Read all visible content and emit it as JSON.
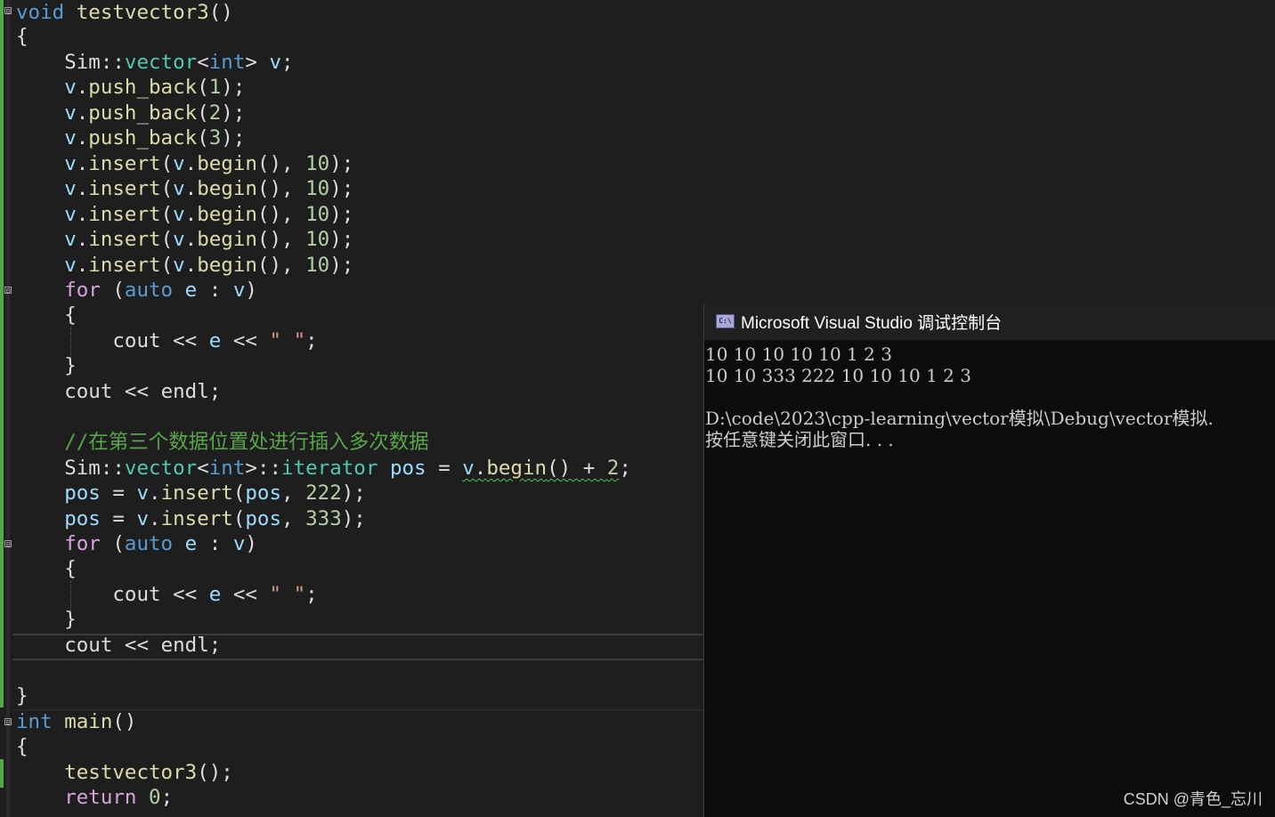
{
  "editor": {
    "code": {
      "l1": {
        "kw": "void",
        "fn": "testvector3",
        "p": "()"
      },
      "l2": {
        "p": "{"
      },
      "l3": {
        "ns": "Sim",
        "sep": "::",
        "typ": "vector",
        "lt": "<",
        "kw": "int",
        "gt": ">",
        "var": "v",
        "end": ";"
      },
      "l4": {
        "var": "v",
        "dot": ".",
        "fn": "push_back",
        "po": "(",
        "num": "1",
        "pc": ");"
      },
      "l5": {
        "var": "v",
        "dot": ".",
        "fn": "push_back",
        "po": "(",
        "num": "2",
        "pc": ");"
      },
      "l6": {
        "var": "v",
        "dot": ".",
        "fn": "push_back",
        "po": "(",
        "num": "3",
        "pc": ");"
      },
      "l7": {
        "var": "v",
        "dot": ".",
        "fn": "insert",
        "po": "(",
        "var2": "v",
        "dot2": ".",
        "fn2": "begin",
        "pp": "(), ",
        "num": "10",
        "pc": ");"
      },
      "l8": {
        "var": "v",
        "dot": ".",
        "fn": "insert",
        "po": "(",
        "var2": "v",
        "dot2": ".",
        "fn2": "begin",
        "pp": "(), ",
        "num": "10",
        "pc": ");"
      },
      "l9": {
        "var": "v",
        "dot": ".",
        "fn": "insert",
        "po": "(",
        "var2": "v",
        "dot2": ".",
        "fn2": "begin",
        "pp": "(), ",
        "num": "10",
        "pc": ");"
      },
      "l10": {
        "var": "v",
        "dot": ".",
        "fn": "insert",
        "po": "(",
        "var2": "v",
        "dot2": ".",
        "fn2": "begin",
        "pp": "(), ",
        "num": "10",
        "pc": ");"
      },
      "l11": {
        "var": "v",
        "dot": ".",
        "fn": "insert",
        "po": "(",
        "var2": "v",
        "dot2": ".",
        "fn2": "begin",
        "pp": "(), ",
        "num": "10",
        "pc": ");"
      },
      "l12": {
        "ctl": "for",
        "po": " (",
        "kw": "auto",
        "sp1": " ",
        "var": "e",
        "colon": " : ",
        "var2": "v",
        "pc": ")"
      },
      "l13": {
        "p": "{"
      },
      "l14": {
        "ident": "cout",
        "op1": " << ",
        "var": "e",
        "op2": " << ",
        "str": "\" \"",
        "end": ";"
      },
      "l15": {
        "p": "}"
      },
      "l16": {
        "ident": "cout",
        "op1": " << ",
        "ident2": "endl",
        "end": ";"
      },
      "l18": {
        "cmt": "//在第三个数据位置处进行插入多次数据"
      },
      "l19": {
        "ns": "Sim",
        "sep": "::",
        "typ": "vector",
        "lt": "<",
        "kw": "int",
        "gt": ">",
        "sep2": "::",
        "typ2": "iterator",
        "sp": " ",
        "var": "pos",
        "eq": " = ",
        "var2": "v",
        "dot": ".",
        "fn": "begin",
        "pp": "() + ",
        "num": "2",
        "end": ";"
      },
      "l20": {
        "var": "pos",
        "eq": " = ",
        "var2": "v",
        "dot": ".",
        "fn": "insert",
        "po": "(",
        "var3": "pos",
        "comma": ", ",
        "num": "222",
        "pc": ");"
      },
      "l21": {
        "var": "pos",
        "eq": " = ",
        "var2": "v",
        "dot": ".",
        "fn": "insert",
        "po": "(",
        "var3": "pos",
        "comma": ", ",
        "num": "333",
        "pc": ");"
      },
      "l22": {
        "ctl": "for",
        "po": " (",
        "kw": "auto",
        "sp1": " ",
        "var": "e",
        "colon": " : ",
        "var2": "v",
        "pc": ")"
      },
      "l23": {
        "p": "{"
      },
      "l24": {
        "ident": "cout",
        "op1": " << ",
        "var": "e",
        "op2": " << ",
        "str": "\" \"",
        "end": ";"
      },
      "l25": {
        "p": "}"
      },
      "l26": {
        "ident": "cout",
        "op1": " << ",
        "ident2": "endl",
        "end": ";"
      },
      "l28": {
        "p": "}"
      },
      "l29": {
        "kw": "int",
        "sp": " ",
        "fn": "main",
        "p": "()"
      },
      "l30": {
        "p": "{"
      },
      "l31": {
        "fn": "testvector3",
        "p": "();"
      },
      "l32": {
        "ctl": "return",
        "sp": " ",
        "num": "0",
        "end": ";"
      }
    },
    "fold_glyph": "⊟"
  },
  "console": {
    "icon_text": "C:\\",
    "title": "Microsoft Visual Studio 调试控制台",
    "lines": [
      "10 10 10 10 10 1 2 3",
      "10 10 333 222 10 10 10 1 2 3",
      "",
      "D:\\code\\2023\\cpp-learning\\vector模拟\\Debug\\vector模拟.",
      "按任意键关闭此窗口. . ."
    ]
  },
  "watermark": "CSDN @青色_忘川",
  "colors": {
    "keyword": "#569cd6",
    "type": "#4ec9b0",
    "variable": "#9cdcfe",
    "function": "#dcdcaa",
    "number": "#b5cea8",
    "comment": "#57a64a",
    "string": "#d69d85",
    "control": "#d8a0df",
    "change_marker": "#57a64a"
  }
}
